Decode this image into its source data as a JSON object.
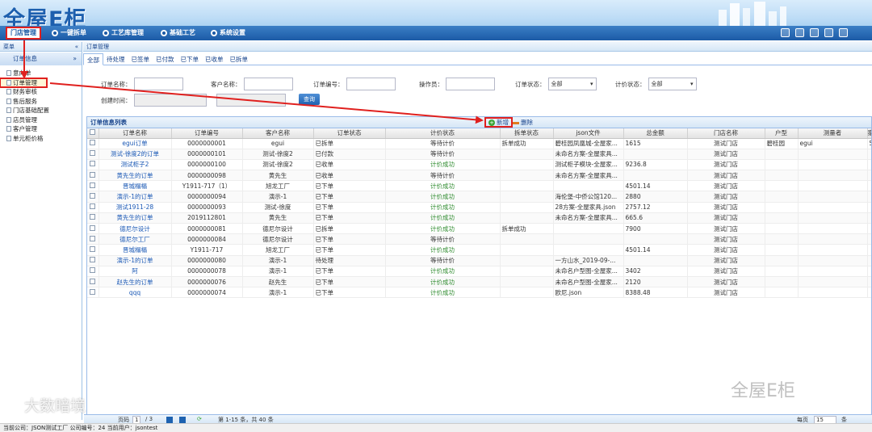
{
  "header": {
    "logo": "全屋E柜",
    "nav": [
      {
        "label": "门店管理",
        "active": true
      },
      {
        "label": "一键拆单",
        "active": false
      },
      {
        "label": "工艺库管理",
        "active": false
      },
      {
        "label": "基础工艺",
        "active": false
      },
      {
        "label": "系统设置",
        "active": false
      }
    ]
  },
  "sidebar": {
    "head": "菜单",
    "collapse": "«",
    "group": "订单信息",
    "group_collapse": "»",
    "items": [
      "意向单",
      "订单管理",
      "财务审核",
      "售后服务",
      "门店基础配置",
      "店员管理",
      "客户管理",
      "单元柜价格"
    ]
  },
  "main": {
    "head": "订单管理",
    "tabs": [
      "全部",
      "待处理",
      "已签单",
      "已付款",
      "已下单",
      "已收单",
      "已拆单"
    ]
  },
  "search": {
    "order_name": "订单名称：",
    "customer_name": "客户名称：",
    "order_no": "订单编号：",
    "operator": "操作员：",
    "order_status": "订单状态：",
    "order_status_value": "全部",
    "price_status": "计价状态：",
    "price_status_value": "全部",
    "create_time": "创建时间：",
    "query": "查询"
  },
  "grid": {
    "title": "订单信息列表",
    "add": "新增",
    "delete": "删除",
    "columns": [
      "订单名称",
      "订单编号",
      "客户名称",
      "订单状态",
      "计价状态",
      "拆单状态",
      "json文件",
      "总金额",
      "门店名称",
      "户型",
      "测量者",
      "家庭人数"
    ],
    "rows": [
      [
        "egui订单",
        "0000000001",
        "egui",
        "已拆单",
        "等待计价",
        "拆单成功",
        "碧桂园凤凰城-全屋家...",
        "1615",
        "测试门店",
        "碧桂园",
        "egui",
        "5"
      ],
      [
        "测试-徐度2的订单",
        "0000000101",
        "测试-徐度2",
        "已付款",
        "等待计价",
        "",
        "未命名方案-全屋家具...",
        "",
        "测试门店",
        "",
        "",
        ""
      ],
      [
        "测试柜子2",
        "0000000100",
        "测试-徐度2",
        "已收单",
        "计价成功",
        "",
        "测试柜子模块-全屋家...",
        "9236.8",
        "测试门店",
        "",
        "",
        ""
      ],
      [
        "黄先生的订单",
        "0000000098",
        "黄先生",
        "已收单",
        "等待计价",
        "",
        "未命名方案-全屋家具...",
        "",
        "测试门店",
        "",
        "",
        ""
      ],
      [
        "晋城榻榻",
        "Y1911-717（1）",
        "旭龙工厂",
        "已下单",
        "计价成功",
        "",
        "",
        "4501.14",
        "测试门店",
        "",
        "",
        ""
      ],
      [
        "演示-1的订单",
        "0000000094",
        "演示-1",
        "已下单",
        "计价成功",
        "",
        "海伦堡-中侨公馆120...",
        "2880",
        "测试门店",
        "",
        "",
        ""
      ],
      [
        "测试1911-28",
        "0000000093",
        "测试-徐度",
        "已下单",
        "计价成功",
        "",
        "28方案-全屋家具.json",
        "2757.12",
        "测试门店",
        "",
        "",
        ""
      ],
      [
        "黄先生的订单",
        "2019112801",
        "黄先生",
        "已下单",
        "计价成功",
        "",
        "未命名方案-全屋家具...",
        "665.6",
        "测试门店",
        "",
        "",
        ""
      ],
      [
        "德尼尔设计",
        "0000000081",
        "德尼尔设计",
        "已拆单",
        "计价成功",
        "拆单成功",
        "",
        "7900",
        "测试门店",
        "",
        "",
        ""
      ],
      [
        "德尼尔工厂",
        "0000000084",
        "德尼尔设计",
        "已下单",
        "等待计价",
        "",
        "",
        "",
        "测试门店",
        "",
        "",
        ""
      ],
      [
        "晋城榻榻",
        "Y1911-717",
        "旭龙工厂",
        "已下单",
        "计价成功",
        "",
        "",
        "4501.14",
        "测试门店",
        "",
        "",
        ""
      ],
      [
        "演示-1的订单",
        "0000000080",
        "演示-1",
        "待处理",
        "等待计价",
        "",
        "一方山水_2019-09-...",
        "",
        "测试门店",
        "",
        "",
        ""
      ],
      [
        "阿",
        "0000000078",
        "演示-1",
        "已下单",
        "计价成功",
        "",
        "未命名户型图-全屋家...",
        "3402",
        "测试门店",
        "",
        "",
        ""
      ],
      [
        "赵先生的订单",
        "0000000076",
        "赵先生",
        "已下单",
        "计价成功",
        "",
        "未命名户型图-全屋家...",
        "2120",
        "测试门店",
        "",
        "",
        ""
      ],
      [
        "qqq",
        "0000000074",
        "演示-1",
        "已下单",
        "计价成功",
        "",
        "欧尼.json",
        "8388.48",
        "测试门店",
        "",
        "",
        ""
      ]
    ]
  },
  "pager": {
    "page_label": "页码",
    "page_value": "1",
    "total_pages": "/ 3",
    "summary": "第 1-15 条，共 40 条",
    "per_page_label": "每页",
    "per_page_value": "15",
    "per_page_unit": "条"
  },
  "status": {
    "text": "当前公司：JSON测试工厂  公司编号：24  当前用户：jsontest"
  },
  "watermarks": {
    "left": "大数暗境",
    "right": "全屋E柜"
  },
  "colors": {
    "nav_blue": "#1b5aa6",
    "annotation_red": "#e0201e",
    "success_green": "#2e8b2e",
    "link_blue": "#1a58b5"
  }
}
